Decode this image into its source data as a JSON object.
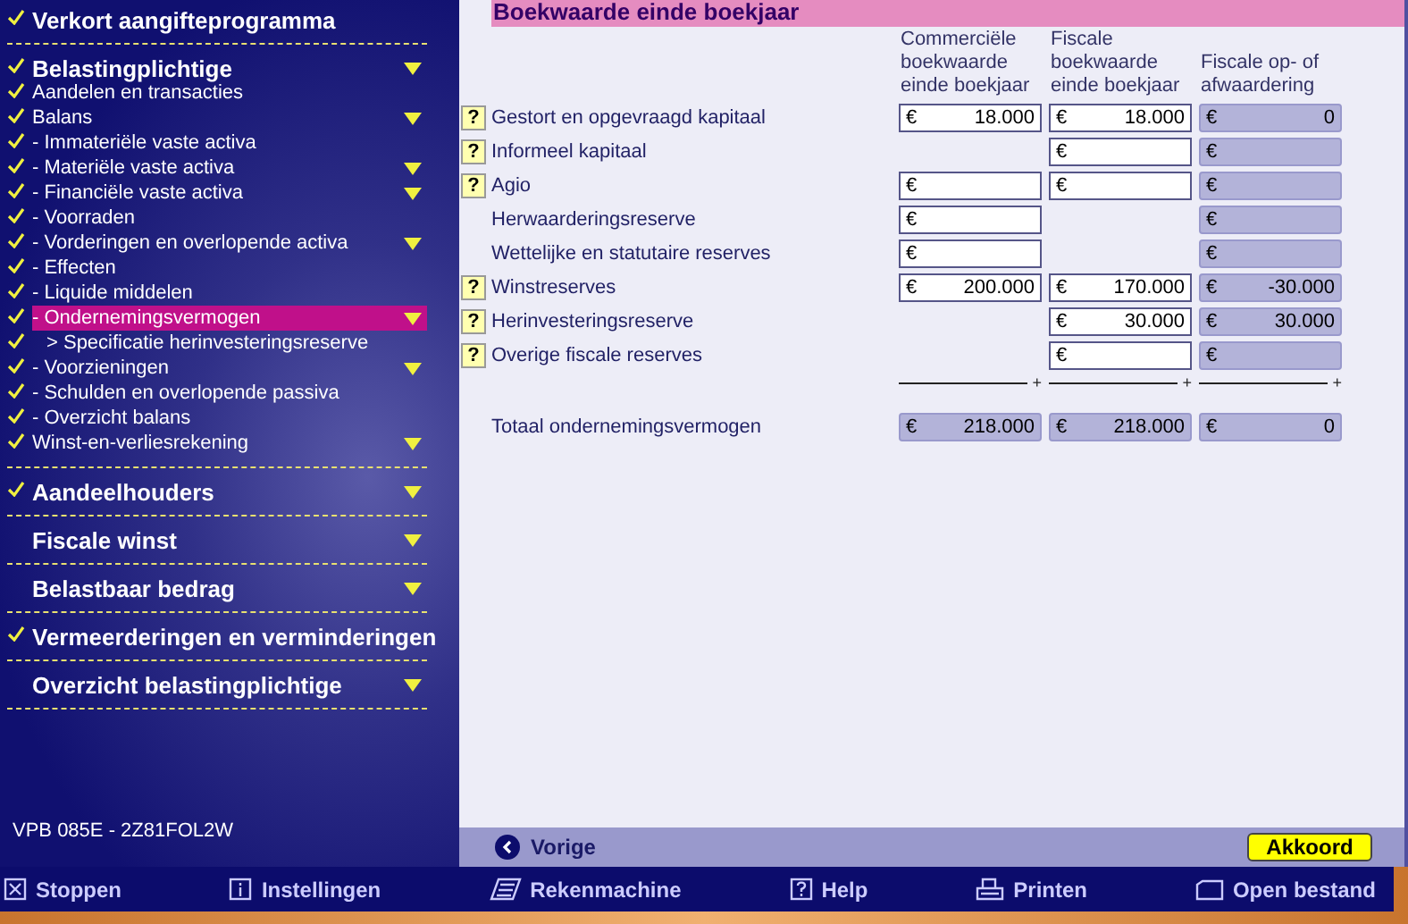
{
  "sidebar": {
    "groups": [
      {
        "items": [
          {
            "label": "Verkort aangifteprogramma",
            "kind": "header",
            "checked": true,
            "caret": false,
            "selected": false
          }
        ]
      },
      {
        "items": [
          {
            "label": "Belastingplichtige",
            "kind": "header",
            "checked": true,
            "caret": true,
            "selected": false
          },
          {
            "label": "Aandelen en transacties",
            "kind": "item",
            "checked": true,
            "caret": false,
            "selected": false
          },
          {
            "label": "Balans",
            "kind": "item",
            "checked": true,
            "caret": true,
            "selected": false
          },
          {
            "label": "- Immateriële vaste activa",
            "kind": "item",
            "checked": true,
            "caret": false,
            "selected": false
          },
          {
            "label": "- Materiële vaste activa",
            "kind": "item",
            "checked": true,
            "caret": true,
            "selected": false
          },
          {
            "label": "- Financiële vaste activa",
            "kind": "item",
            "checked": true,
            "caret": true,
            "selected": false
          },
          {
            "label": "- Voorraden",
            "kind": "item",
            "checked": true,
            "caret": false,
            "selected": false
          },
          {
            "label": "- Vorderingen en overlopende activa",
            "kind": "item",
            "checked": true,
            "caret": true,
            "selected": false
          },
          {
            "label": "- Effecten",
            "kind": "item",
            "checked": true,
            "caret": false,
            "selected": false
          },
          {
            "label": "- Liquide middelen",
            "kind": "item",
            "checked": true,
            "caret": false,
            "selected": false
          },
          {
            "label": "- Ondernemingsvermogen",
            "kind": "item",
            "checked": true,
            "caret": true,
            "selected": true
          },
          {
            "label": "> Specificatie herinvesteringsreserve",
            "kind": "subitem",
            "checked": true,
            "caret": false,
            "selected": false
          },
          {
            "label": "- Voorzieningen",
            "kind": "item",
            "checked": true,
            "caret": true,
            "selected": false
          },
          {
            "label": "- Schulden en overlopende passiva",
            "kind": "item",
            "checked": true,
            "caret": false,
            "selected": false
          },
          {
            "label": "- Overzicht balans",
            "kind": "item",
            "checked": true,
            "caret": false,
            "selected": false
          },
          {
            "label": "Winst-en-verliesrekening",
            "kind": "item",
            "checked": true,
            "caret": true,
            "selected": false
          }
        ]
      },
      {
        "items": [
          {
            "label": "Aandeelhouders",
            "kind": "header",
            "checked": true,
            "caret": true,
            "selected": false
          }
        ]
      },
      {
        "items": [
          {
            "label": "Fiscale winst",
            "kind": "header",
            "checked": false,
            "caret": true,
            "selected": false
          }
        ]
      },
      {
        "items": [
          {
            "label": "Belastbaar bedrag",
            "kind": "header",
            "checked": false,
            "caret": true,
            "selected": false
          }
        ]
      },
      {
        "items": [
          {
            "label": "Vermeerderingen en verminderingen",
            "kind": "header",
            "checked": true,
            "caret": false,
            "selected": false
          }
        ]
      },
      {
        "items": [
          {
            "label": "Overzicht belastingplichtige",
            "kind": "header",
            "checked": false,
            "caret": true,
            "selected": false
          }
        ]
      }
    ],
    "version": "VPB 085E - 2Z81FOL2W"
  },
  "form": {
    "title": "Boekwaarde einde boekjaar",
    "currency": "€",
    "columns": [
      "Commerciële boekwaarde einde boekjaar",
      "Fiscale boekwaarde einde boekjaar",
      "Fiscale op- of afwaardering"
    ],
    "rows": [
      {
        "label": "Gestort en opgevraagd kapitaal",
        "help": "?",
        "cells": [
          {
            "value": "18.000",
            "readonly": false
          },
          {
            "value": "18.000",
            "readonly": false
          },
          {
            "value": "0",
            "readonly": true
          }
        ]
      },
      {
        "label": "Informeel kapitaal",
        "help": "?",
        "cells": [
          null,
          {
            "readonly": false
          },
          {
            "readonly": true
          }
        ]
      },
      {
        "label": "Agio",
        "help": "?",
        "cells": [
          {
            "readonly": false
          },
          {
            "readonly": false
          },
          {
            "readonly": true
          }
        ]
      },
      {
        "label": "Herwaarderingsreserve",
        "cells": [
          {
            "readonly": false
          },
          null,
          {
            "readonly": true
          }
        ]
      },
      {
        "label": "Wettelijke en statutaire reserves",
        "cells": [
          {
            "readonly": false
          },
          null,
          {
            "readonly": true
          }
        ]
      },
      {
        "label": "Winstreserves",
        "help": "?",
        "cells": [
          {
            "value": "200.000",
            "readonly": false
          },
          {
            "value": "170.000",
            "readonly": false
          },
          {
            "value": "-30.000",
            "readonly": true
          }
        ]
      },
      {
        "label": "Herinvesteringsreserve",
        "help": "?",
        "cells": [
          null,
          {
            "value": "30.000",
            "readonly": false
          },
          {
            "value": "30.000",
            "readonly": true
          }
        ]
      },
      {
        "label": "Overige fiscale reserves",
        "help": "?",
        "cells": [
          null,
          {
            "readonly": false
          },
          {
            "readonly": true
          }
        ]
      }
    ],
    "sum_marks": [
      "+",
      "+",
      "+"
    ],
    "total": {
      "label": "Totaal ondernemingsvermogen",
      "cells": [
        {
          "value": "218.000",
          "readonly": true
        },
        {
          "value": "218.000",
          "readonly": true
        },
        {
          "value": "0",
          "readonly": true
        }
      ]
    }
  },
  "nav": {
    "back": "Vorige",
    "ok": "Akkoord"
  },
  "toolbar": [
    {
      "label": "Stoppen",
      "kind": "stop"
    },
    {
      "label": "Instellingen",
      "kind": "info"
    },
    {
      "label": "Rekenmachine",
      "kind": "calc"
    },
    {
      "label": "Help",
      "kind": "help"
    },
    {
      "label": "Printen",
      "kind": "print"
    },
    {
      "label": "Open bestand",
      "kind": "open"
    }
  ]
}
